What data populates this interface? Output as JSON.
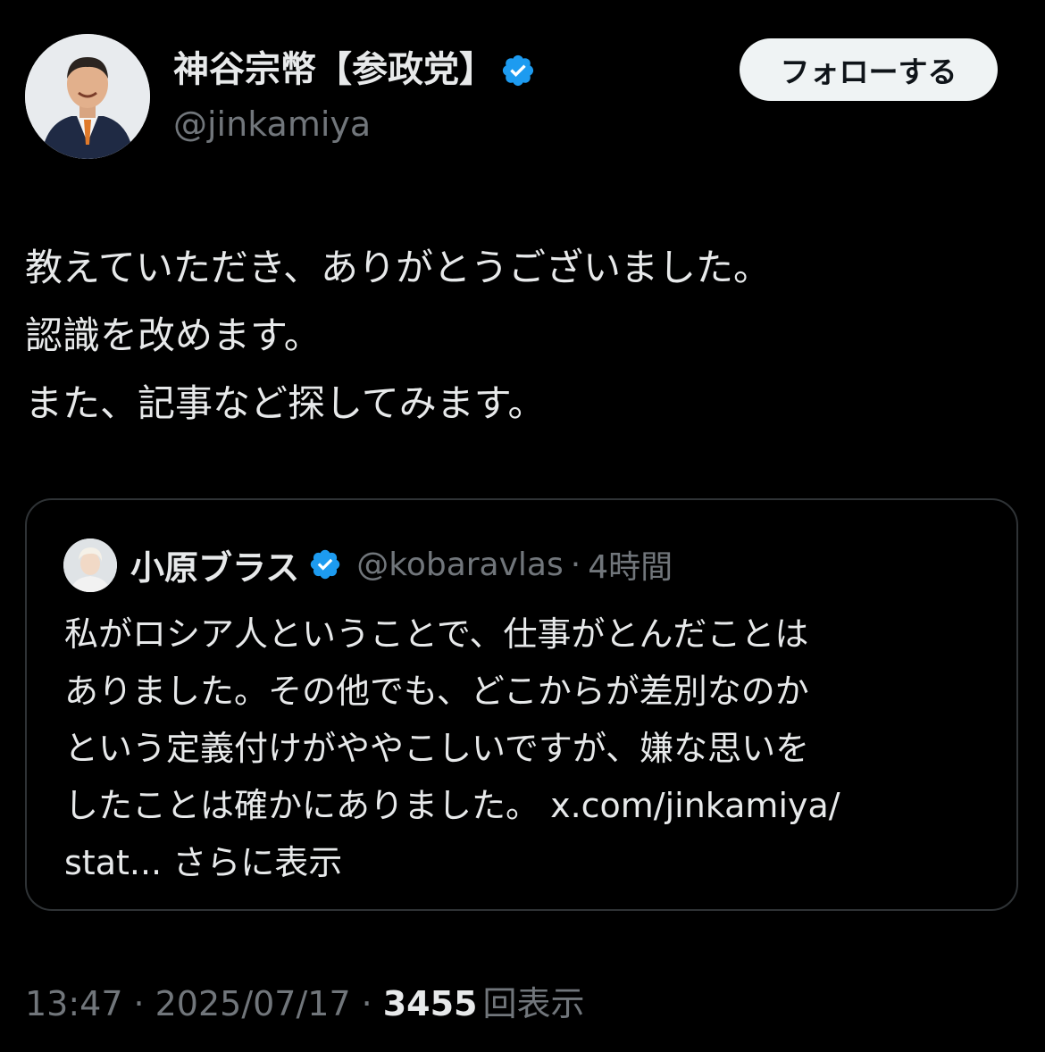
{
  "author": {
    "name": "神谷宗幣【参政党】",
    "handle": "@jinkamiya",
    "verified_color": "#1d9bf0"
  },
  "follow_button_label": "フォローする",
  "tweet": {
    "lines": [
      "教えていただき、ありがとうございました。",
      "認識を改めます。",
      "また、記事など探してみます。"
    ]
  },
  "quote": {
    "name": "小原ブラス",
    "handle": "@kobaravlas",
    "separator": "·",
    "time": "4時間",
    "lines": [
      "私がロシア人ということで、仕事がとんだことは",
      "ありました。その他でも、どこからが差別なのか",
      "という定義付けがややこしいですが、嫌な思いを",
      "したことは確かにありました。 x.com/jinkamiya/"
    ],
    "last_line": "stat...",
    "show_more": "さらに表示"
  },
  "meta": {
    "time": "13:47",
    "separator": "·",
    "date": "2025/07/17",
    "views_count": "3455",
    "views_label": "回表示"
  },
  "colors": {
    "background": "#000000",
    "text_primary": "#e7e9ea",
    "text_secondary": "#71767b",
    "border": "#2f3336",
    "button_bg": "#eff3f4"
  },
  "icons": {
    "verified": "verified-badge-icon"
  }
}
